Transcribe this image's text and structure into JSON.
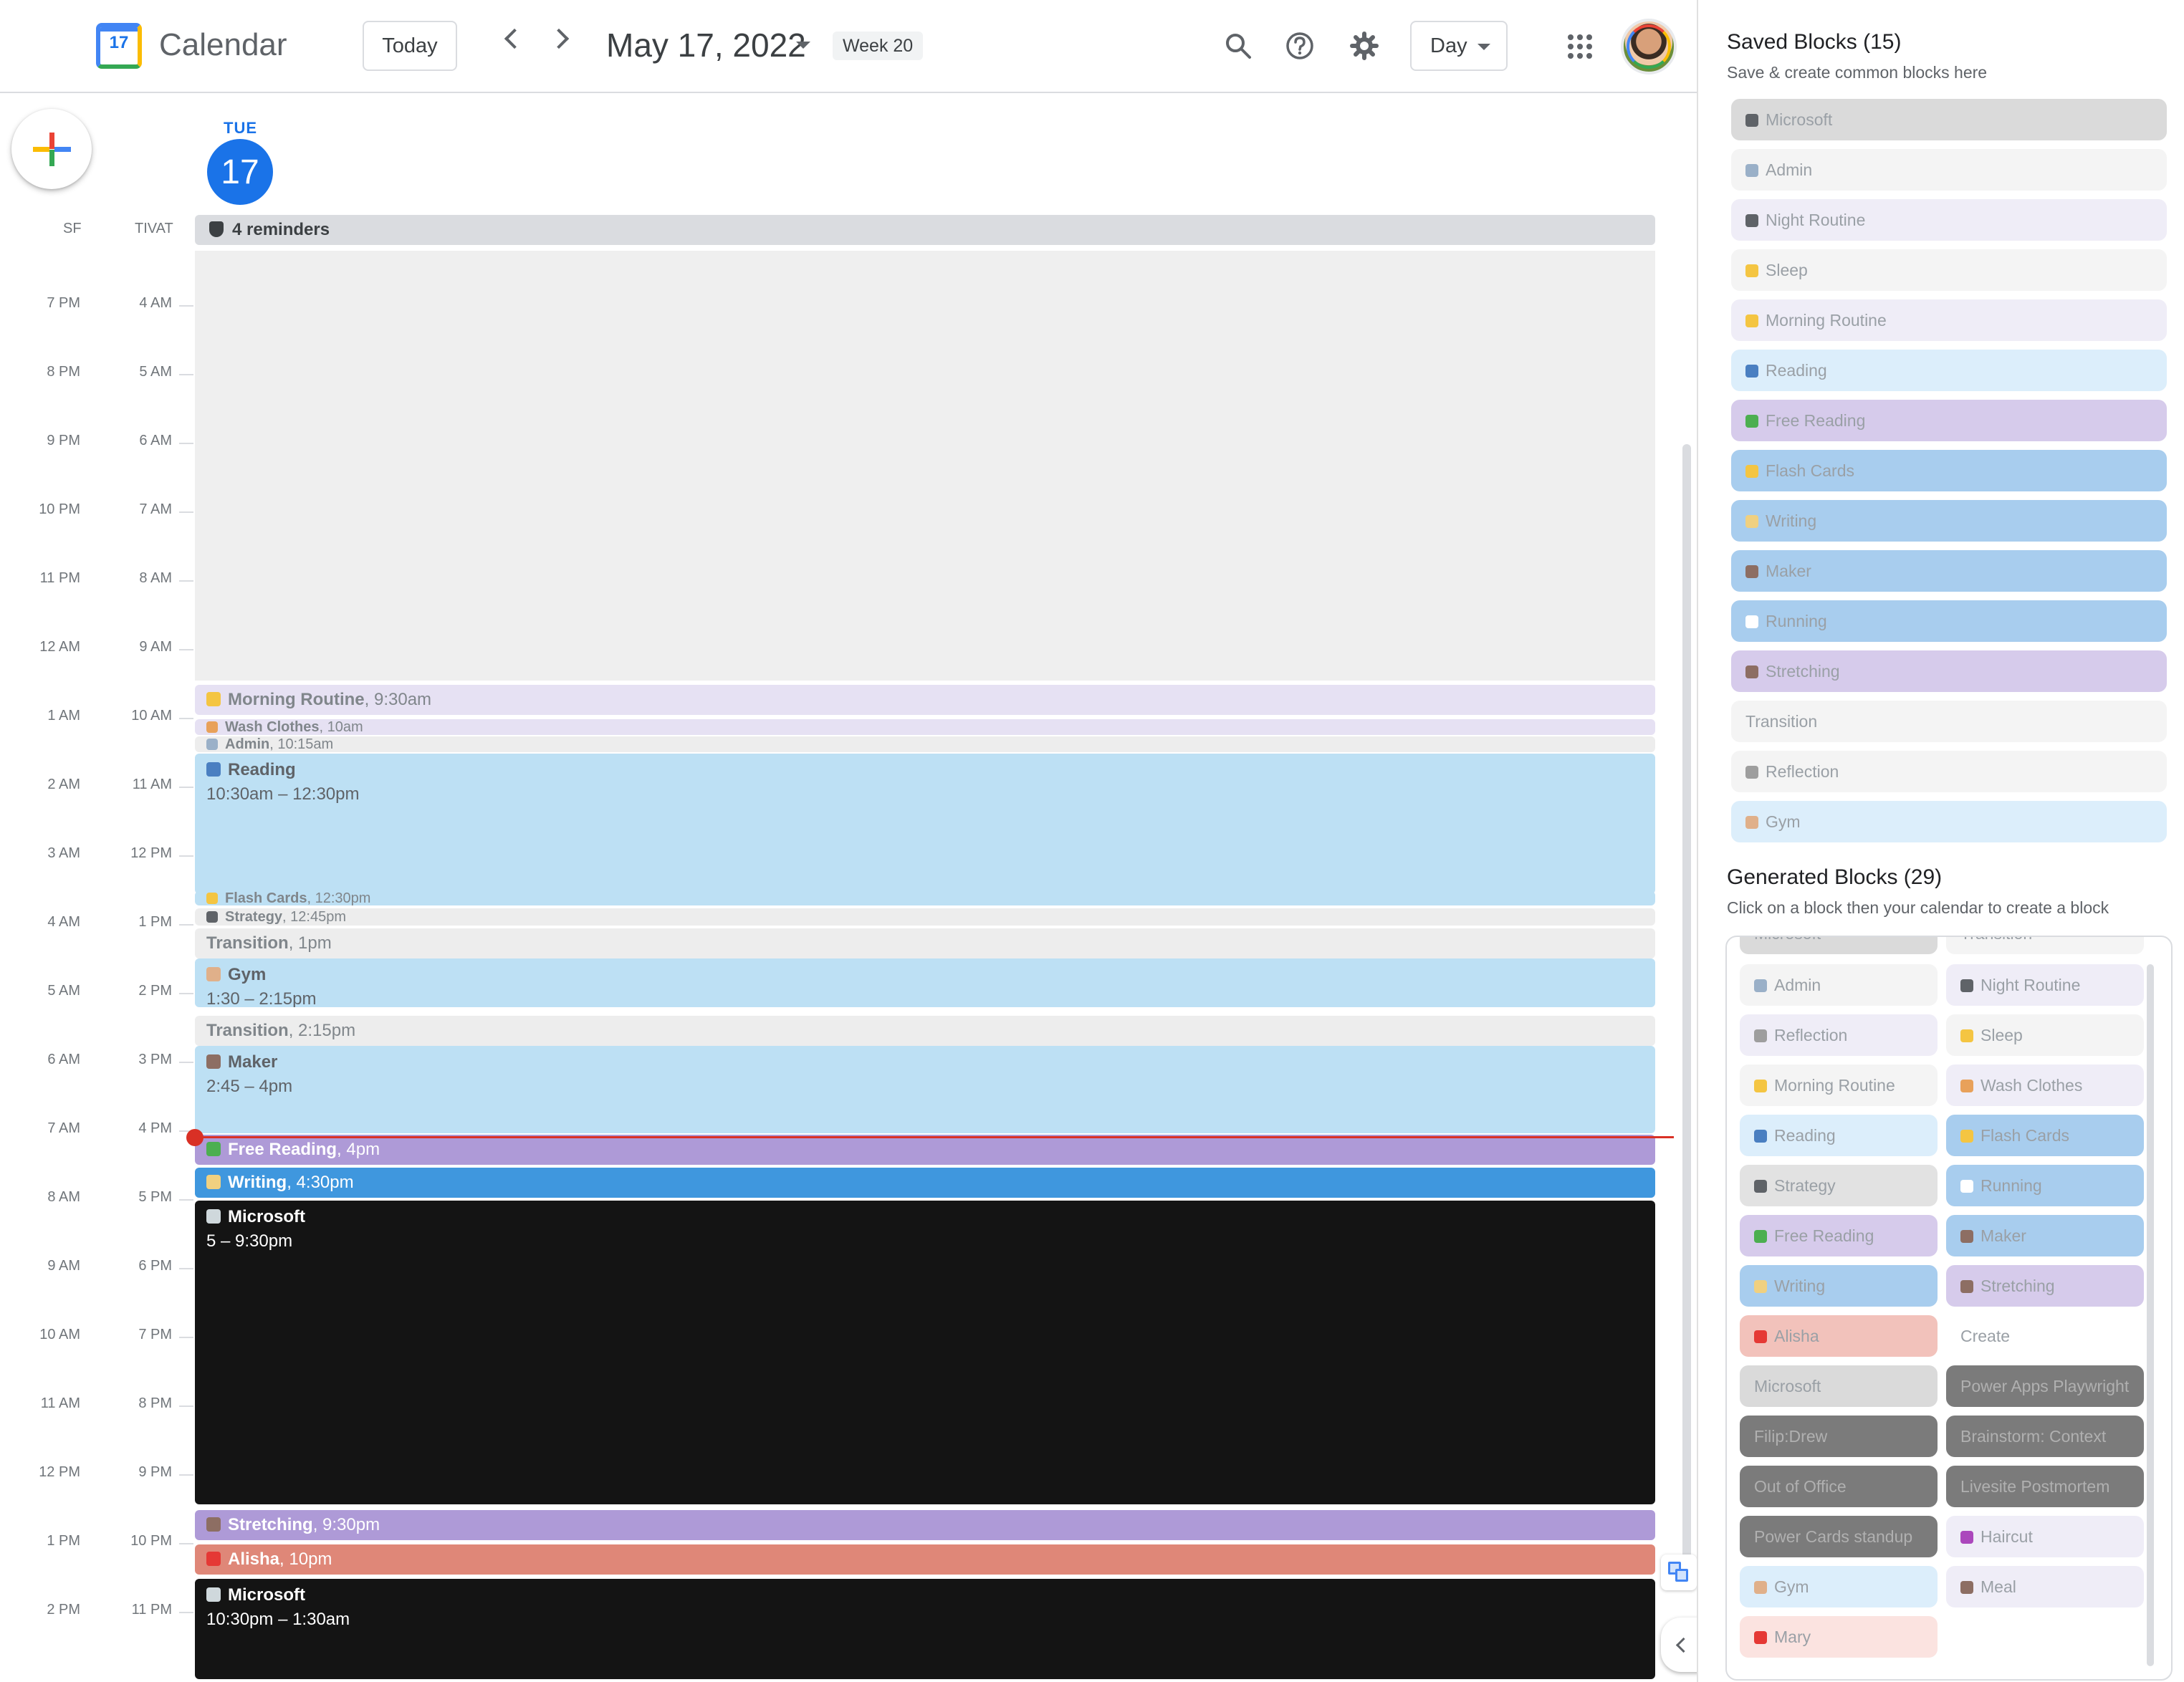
{
  "app": {
    "title": "Calendar",
    "logo_day": "17",
    "today_label": "Today",
    "date_title": "May 17, 2022",
    "week_chip": "Week 20",
    "view_mode": "Day"
  },
  "day": {
    "name": "TUE",
    "number": "17",
    "tz_primary": "SF",
    "tz_secondary": "TIVAT",
    "reminders_label": "4 reminders"
  },
  "times": [
    {
      "sf": "7 PM",
      "tivat": "4 AM"
    },
    {
      "sf": "8 PM",
      "tivat": "5 AM"
    },
    {
      "sf": "9 PM",
      "tivat": "6 AM"
    },
    {
      "sf": "10 PM",
      "tivat": "7 AM"
    },
    {
      "sf": "11 PM",
      "tivat": "8 AM"
    },
    {
      "sf": "12 AM",
      "tivat": "9 AM"
    },
    {
      "sf": "1 AM",
      "tivat": "10 AM"
    },
    {
      "sf": "2 AM",
      "tivat": "11 AM"
    },
    {
      "sf": "3 AM",
      "tivat": "12 PM"
    },
    {
      "sf": "4 AM",
      "tivat": "1 PM"
    },
    {
      "sf": "5 AM",
      "tivat": "2 PM"
    },
    {
      "sf": "6 AM",
      "tivat": "3 PM"
    },
    {
      "sf": "7 AM",
      "tivat": "4 PM"
    },
    {
      "sf": "8 AM",
      "tivat": "5 PM"
    },
    {
      "sf": "9 AM",
      "tivat": "6 PM"
    },
    {
      "sf": "10 AM",
      "tivat": "7 PM"
    },
    {
      "sf": "11 AM",
      "tivat": "8 PM"
    },
    {
      "sf": "12 PM",
      "tivat": "9 PM"
    },
    {
      "sf": "1 PM",
      "tivat": "10 PM"
    },
    {
      "sf": "2 PM",
      "tivat": "11 PM"
    }
  ],
  "events": [
    {
      "title": "Morning Routine",
      "time": ", 9:30am",
      "color": "#e6e1f3",
      "text_color": "#80868b",
      "icon_color": "#f4c542"
    },
    {
      "title": "Wash Clothes",
      "time": ", 10am",
      "color": "#e6e1f3",
      "text_color": "#80868b",
      "icon_color": "#e8a15a"
    },
    {
      "title": "Admin",
      "time": ", 10:15am",
      "color": "#ededed",
      "text_color": "#80868b",
      "icon_color": "#9ab0c8"
    },
    {
      "title": "Reading",
      "time": "10:30am – 12:30pm",
      "color": "#bde0f4",
      "text_color": "#5f6368",
      "icon_color": "#4a7fc1"
    },
    {
      "title": "Flash Cards",
      "time": ", 12:30pm",
      "color": "#bde0f4",
      "text_color": "#80868b",
      "icon_color": "#f4c542"
    },
    {
      "title": "Strategy",
      "time": ", 12:45pm",
      "color": "#ededed",
      "text_color": "#80868b",
      "icon_color": "#5f6368"
    },
    {
      "title": "Transition",
      "time": ", 1pm",
      "color": "#ededed",
      "text_color": "#80868b",
      "icon_color": ""
    },
    {
      "title": "Gym",
      "time": "1:30 – 2:15pm",
      "color": "#bde0f4",
      "text_color": "#5f6368",
      "icon_color": "#e0b08a"
    },
    {
      "title": "Transition",
      "time": ", 2:15pm",
      "color": "#ededed",
      "text_color": "#80868b",
      "icon_color": ""
    },
    {
      "title": "Maker",
      "time": "2:45 – 4pm",
      "color": "#bde0f4",
      "text_color": "#5f6368",
      "icon_color": "#8d6e63"
    },
    {
      "title": "Free Reading",
      "time": ", 4pm",
      "color": "#ae9ad7",
      "text_color": "#ffffff",
      "icon_color": "#4caf50"
    },
    {
      "title": "Writing",
      "time": ", 4:30pm",
      "color": "#3f97de",
      "text_color": "#ffffff",
      "icon_color": "#f0d080"
    },
    {
      "title": "Microsoft",
      "time": "5 – 9:30pm",
      "color": "#141414",
      "text_color": "#ffffff",
      "icon_color": "#cfd8dc"
    },
    {
      "title": "Stretching",
      "time": ", 9:30pm",
      "color": "#ae9ad7",
      "text_color": "#ffffff",
      "icon_color": "#8d6e63"
    },
    {
      "title": "Alisha",
      "time": ", 10pm",
      "color": "#df8778",
      "text_color": "#ffffff",
      "icon_color": "#e53935"
    },
    {
      "title": "Microsoft",
      "time": "10:30pm – 1:30am",
      "color": "#141414",
      "text_color": "#ffffff",
      "icon_color": "#cfd8dc"
    }
  ],
  "panel": {
    "saved_title": "Saved Blocks (15)",
    "saved_sub": "Save & create common blocks here",
    "saved_blocks": [
      {
        "label": "Microsoft",
        "color": "#dadada",
        "icon_color": "#5f6368"
      },
      {
        "label": "Admin",
        "color": "#f4f4f4",
        "icon_color": "#9ab0c8"
      },
      {
        "label": "Night Routine",
        "color": "#efedf7",
        "icon_color": "#5f6368"
      },
      {
        "label": "Sleep",
        "color": "#f4f4f4",
        "icon_color": "#f4c542"
      },
      {
        "label": "Morning Routine",
        "color": "#efedf7",
        "icon_color": "#f4c542"
      },
      {
        "label": "Reading",
        "color": "#dceefb",
        "icon_color": "#4a7fc1"
      },
      {
        "label": "Free Reading",
        "color": "#d6cbeb",
        "icon_color": "#4caf50"
      },
      {
        "label": "Flash Cards",
        "color": "#a8cdee",
        "icon_color": "#f4c542"
      },
      {
        "label": "Writing",
        "color": "#a8cdee",
        "icon_color": "#f0d080"
      },
      {
        "label": "Maker",
        "color": "#a8cdee",
        "icon_color": "#8d6e63"
      },
      {
        "label": "Running",
        "color": "#a8cdee",
        "icon_color": "#ffffff"
      },
      {
        "label": "Stretching",
        "color": "#d6cbeb",
        "icon_color": "#8d6e63"
      },
      {
        "label": "Transition",
        "color": "#f4f4f4",
        "icon_color": ""
      },
      {
        "label": "Reflection",
        "color": "#f4f4f4",
        "icon_color": "#9e9e9e"
      },
      {
        "label": "Gym",
        "color": "#dceefb",
        "icon_color": "#e0b08a"
      }
    ],
    "generated_title": "Generated Blocks (29)",
    "generated_sub": "Click on a block then your calendar to create a block",
    "generated_partial": [
      {
        "label": "Microsoft",
        "color": "#dadada"
      },
      {
        "label": "Transition",
        "color": "#f4f4f4"
      }
    ],
    "generated_blocks": [
      {
        "label": "Admin",
        "color": "#f4f4f4",
        "icon_color": "#9ab0c8"
      },
      {
        "label": "Night Routine",
        "color": "#efedf7",
        "icon_color": "#5f6368"
      },
      {
        "label": "Reflection",
        "color": "#efedf7",
        "icon_color": "#9e9e9e"
      },
      {
        "label": "Sleep",
        "color": "#f4f4f4",
        "icon_color": "#f4c542"
      },
      {
        "label": "Morning Routine",
        "color": "#f4f4f4",
        "icon_color": "#f4c542"
      },
      {
        "label": "Wash Clothes",
        "color": "#efedf7",
        "icon_color": "#e8a15a"
      },
      {
        "label": "Reading",
        "color": "#dceefb",
        "icon_color": "#4a7fc1"
      },
      {
        "label": "Flash Cards",
        "color": "#a8cdee",
        "icon_color": "#f4c542"
      },
      {
        "label": "Strategy",
        "color": "#e2e2e2",
        "icon_color": "#5f6368"
      },
      {
        "label": "Running",
        "color": "#a8cdee",
        "icon_color": "#ffffff"
      },
      {
        "label": "Free Reading",
        "color": "#d6cbeb",
        "icon_color": "#4caf50"
      },
      {
        "label": "Maker",
        "color": "#a8cdee",
        "icon_color": "#8d6e63"
      },
      {
        "label": "Writing",
        "color": "#a8cdee",
        "icon_color": "#f0d080"
      },
      {
        "label": "Stretching",
        "color": "#d6cbeb",
        "icon_color": "#8d6e63"
      },
      {
        "label": "Alisha",
        "color": "#f2c2bb",
        "icon_color": "#e53935"
      },
      {
        "label": "Create",
        "color": "#ffffff",
        "icon_color": ""
      },
      {
        "label": "Microsoft",
        "color": "#dadada",
        "icon_color": ""
      },
      {
        "label": "Power Apps Playwright",
        "color": "#7b7b7b",
        "icon_color": ""
      },
      {
        "label": "Filip:Drew",
        "color": "#7b7b7b",
        "icon_color": ""
      },
      {
        "label": "Brainstorm: Context",
        "color": "#7b7b7b",
        "icon_color": ""
      },
      {
        "label": "Out of Office",
        "color": "#7b7b7b",
        "icon_color": ""
      },
      {
        "label": "Livesite Postmortem",
        "color": "#7b7b7b",
        "icon_color": ""
      },
      {
        "label": "Power Cards standup",
        "color": "#7b7b7b",
        "icon_color": ""
      },
      {
        "label": "Haircut",
        "color": "#efedf7",
        "icon_color": "#ab47bc"
      },
      {
        "label": "Gym",
        "color": "#dceefb",
        "icon_color": "#e0b08a"
      },
      {
        "label": "Meal",
        "color": "#efedf7",
        "icon_color": "#8d6e63"
      },
      {
        "label": "Mary",
        "color": "#fbe3e0",
        "icon_color": "#e53935"
      }
    ]
  }
}
